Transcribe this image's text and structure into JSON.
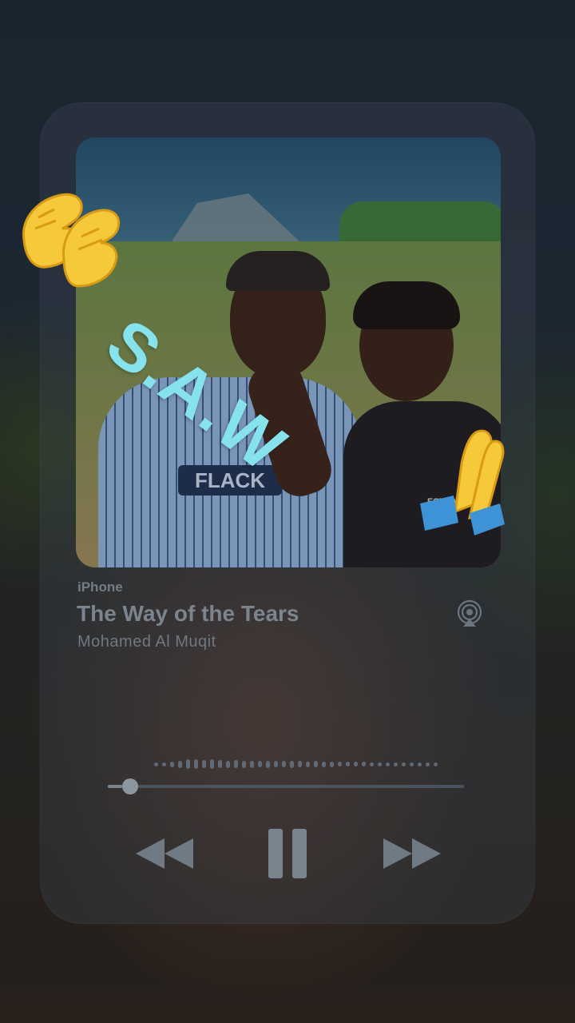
{
  "now_playing": {
    "source": "iPhone",
    "title": "The Way of the Tears",
    "artist": "Mohamed Al Muqit"
  },
  "artwork": {
    "shirt_logo_text": "FLACK",
    "shirt_print_text": "EST.1986"
  },
  "sticker": {
    "text": "S.A.W",
    "color": "#86e2ec",
    "emoji_left": "clapping-hands-icon",
    "emoji_right": "praying-hands-icon"
  },
  "playback": {
    "progress": 0.04,
    "state": "playing"
  },
  "controls": {
    "rewind_icon": "rewind-icon",
    "pause_icon": "pause-icon",
    "forward_icon": "fast-forward-icon",
    "airplay_icon": "airplay-icon"
  },
  "colors": {
    "card": "#46505c",
    "text_muted": "#7b858f",
    "accent_sticker": "#86e2ec",
    "emoji_yellow": "#f6c93b"
  }
}
